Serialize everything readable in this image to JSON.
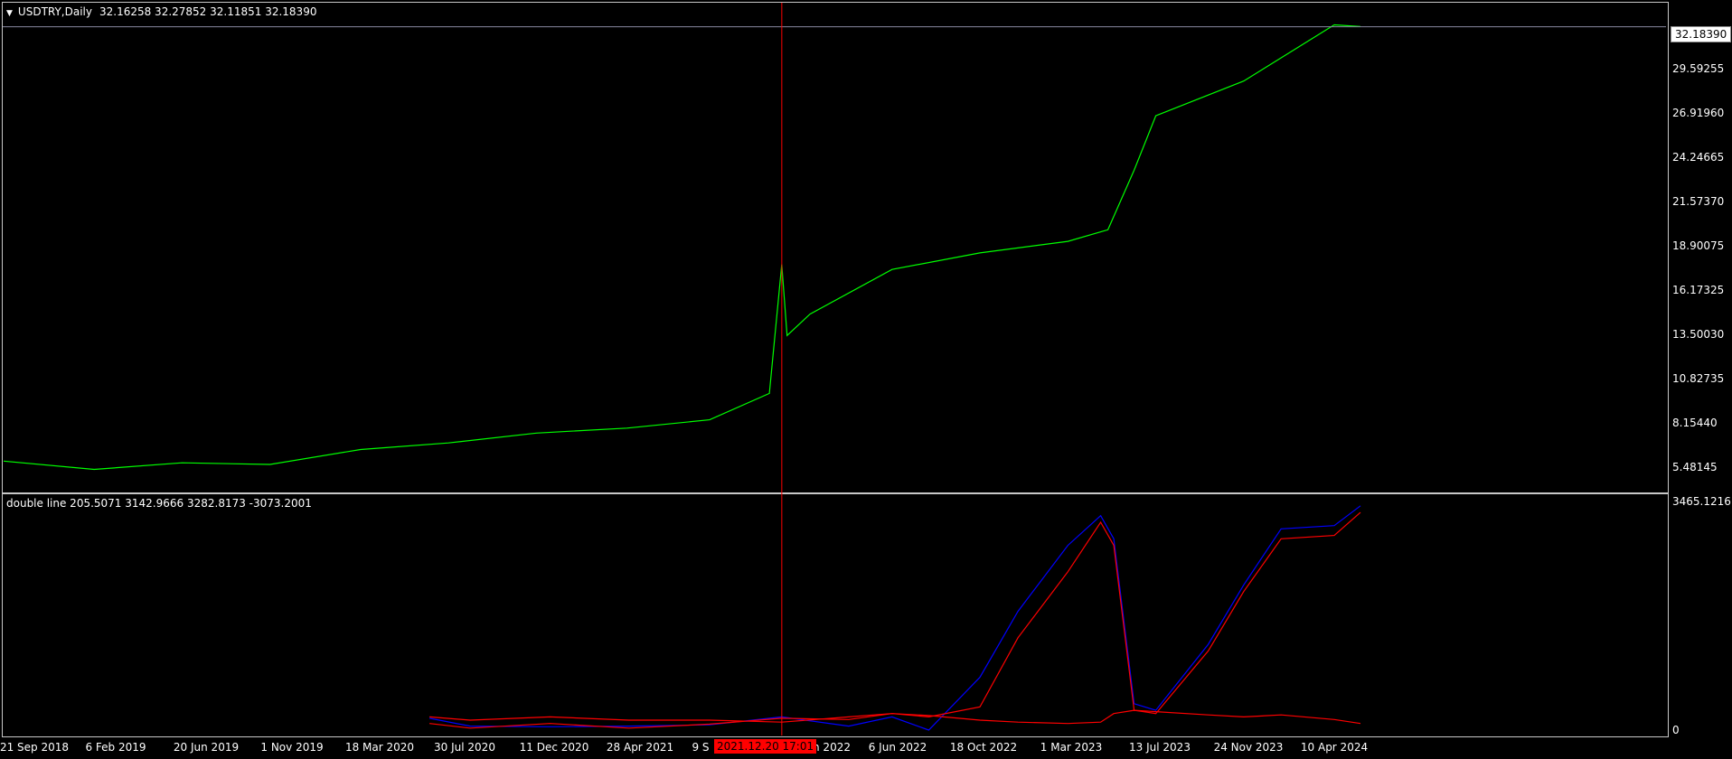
{
  "main": {
    "symbol_label": "USDTRY,Daily",
    "ohlc": "32.16258 32.27852 32.11851 32.18390",
    "current_price": "32.18390",
    "price_axis": [
      "29.59255",
      "26.91960",
      "24.24665",
      "21.57370",
      "18.90075",
      "16.17325",
      "13.50030",
      "10.82735",
      "8.15440",
      "5.48145"
    ]
  },
  "indicator": {
    "label": "double line 205.5071 3142.9666 3282.8173 -3073.2001",
    "axis_top": "3465.1216",
    "axis_bottom": "0"
  },
  "time_axis": [
    "21 Sep 2018",
    "6 Feb 2019",
    "20 Jun 2019",
    "1 Nov 2019",
    "18 Mar 2020",
    "30 Jul 2020",
    "11 Dec 2020",
    "28 Apr 2021",
    "9 S",
    "n 2022",
    "6 Jun 2022",
    "18 Oct 2022",
    "1 Mar 2023",
    "13 Jul 2023",
    "24 Nov 2023",
    "10 Apr 2024"
  ],
  "cursor_date": "2021.12.20 17:01",
  "colors": {
    "price_line": "#00ff00",
    "blue_line": "#0000ff",
    "red_line": "#ff0000",
    "cursor": "#ff0000",
    "grid": "#ffffff"
  },
  "chart_data": [
    {
      "type": "line",
      "title": "USDTRY,Daily",
      "x": [
        "2018-09-21",
        "2019-02-06",
        "2019-06-20",
        "2019-11-01",
        "2020-03-18",
        "2020-07-30",
        "2020-12-11",
        "2021-04-28",
        "2021-09-01",
        "2021-12-01",
        "2021-12-20",
        "2021-12-28",
        "2022-02-01",
        "2022-06-06",
        "2022-10-18",
        "2023-03-01",
        "2023-05-01",
        "2023-06-10",
        "2023-07-13",
        "2023-11-24",
        "2024-04-10",
        "2024-05-20"
      ],
      "series": [
        {
          "name": "USDTRY",
          "values": [
            5.9,
            5.4,
            5.8,
            5.7,
            6.6,
            7.0,
            7.6,
            7.9,
            8.4,
            10.0,
            17.8,
            13.5,
            14.8,
            17.5,
            18.5,
            19.2,
            19.9,
            23.5,
            26.8,
            28.9,
            32.3,
            32.2
          ]
        }
      ],
      "ylim": [
        5.0,
        33.4
      ]
    },
    {
      "type": "line",
      "title": "double line 205.5071 3142.9666 3282.8173 -3073.2001",
      "x": [
        "2020-07-01",
        "2020-09-01",
        "2021-01-01",
        "2021-05-01",
        "2021-09-01",
        "2021-12-20",
        "2022-04-01",
        "2022-06-06",
        "2022-08-01",
        "2022-10-18",
        "2022-12-15",
        "2023-03-01",
        "2023-04-20",
        "2023-05-10",
        "2023-06-10",
        "2023-07-13",
        "2023-10-01",
        "2023-11-24",
        "2024-01-20",
        "2024-04-10",
        "2024-05-20"
      ],
      "series": [
        {
          "name": "",
          "values": [
            180,
            60,
            50,
            60,
            80,
            200,
            60,
            200,
            0,
            800,
            1800,
            2800,
            3250,
            2900,
            400,
            300,
            1300,
            2200,
            3050,
            3100,
            3400
          ]
        },
        {
          "name": "",
          "values": [
            100,
            30,
            100,
            30,
            90,
            180,
            160,
            250,
            200,
            350,
            1400,
            2400,
            3150,
            2800,
            300,
            250,
            1200,
            2100,
            2900,
            2950,
            3300
          ]
        },
        {
          "name": "",
          "values": [
            200,
            150,
            200,
            150,
            150,
            120,
            200,
            250,
            220,
            150,
            120,
            100,
            120,
            250,
            300,
            280,
            230,
            200,
            230,
            160,
            100
          ]
        }
      ],
      "ylim": [
        0,
        3465.1216
      ]
    }
  ]
}
